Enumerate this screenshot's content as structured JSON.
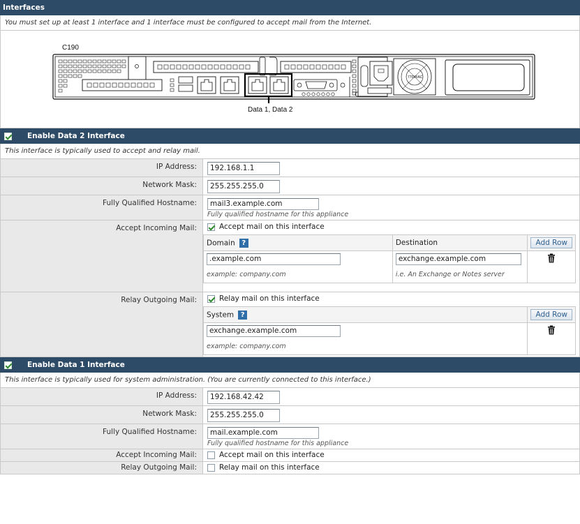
{
  "header": {
    "title": "Interfaces",
    "requirement_note": "You must set up at least 1 interface and 1 interface must be configured to accept mail from the Internet."
  },
  "hardware": {
    "model_label": "C190",
    "port_caption": "Data 1, Data 2",
    "psu_label": "770W/AC"
  },
  "data2": {
    "enable_label": "Enable Data 2 Interface",
    "enabled": true,
    "note": "This interface is typically used to accept and relay mail.",
    "ip_label": "IP Address:",
    "ip_value": "192.168.1.1",
    "mask_label": "Network Mask:",
    "mask_value": "255.255.255.0",
    "hostname_label": "Fully Qualified Hostname:",
    "hostname_value": "mail3.example.com",
    "hostname_hint": "Fully qualified hostname for this appliance",
    "incoming_label": "Accept Incoming Mail:",
    "incoming_checked": true,
    "incoming_text": "Accept mail on this interface",
    "incoming_table": {
      "domain_header": "Domain",
      "destination_header": "Destination",
      "add_row": "Add Row",
      "domain_value": ".example.com",
      "destination_value": "exchange.example.com",
      "domain_hint": "example: company.com",
      "destination_hint": "i.e. An Exchange or Notes server"
    },
    "relay_label": "Relay Outgoing Mail:",
    "relay_checked": true,
    "relay_text": "Relay mail on this interface",
    "relay_table": {
      "system_header": "System",
      "add_row": "Add Row",
      "system_value": "exchange.example.com",
      "system_hint": "example: company.com"
    }
  },
  "data1": {
    "enable_label": "Enable Data 1 Interface",
    "enabled": true,
    "note": "This interface is typically used for system administration.  (You are currently connected to this interface.)",
    "ip_label": "IP Address:",
    "ip_value": "192.168.42.42",
    "mask_label": "Network Mask:",
    "mask_value": "255.255.255.0",
    "hostname_label": "Fully Qualified Hostname:",
    "hostname_value": "mail.example.com",
    "hostname_hint": "Fully qualified hostname for this appliance",
    "incoming_label": "Accept Incoming Mail:",
    "incoming_checked": false,
    "incoming_text": "Accept mail on this interface",
    "relay_label": "Relay Outgoing Mail:",
    "relay_checked": false,
    "relay_text": "Relay mail on this interface"
  },
  "colors": {
    "header_bg": "#2d4a66",
    "label_bg": "#e9e9e9",
    "border": "#c9c9c9",
    "help_icon": "#2f6ea8"
  }
}
